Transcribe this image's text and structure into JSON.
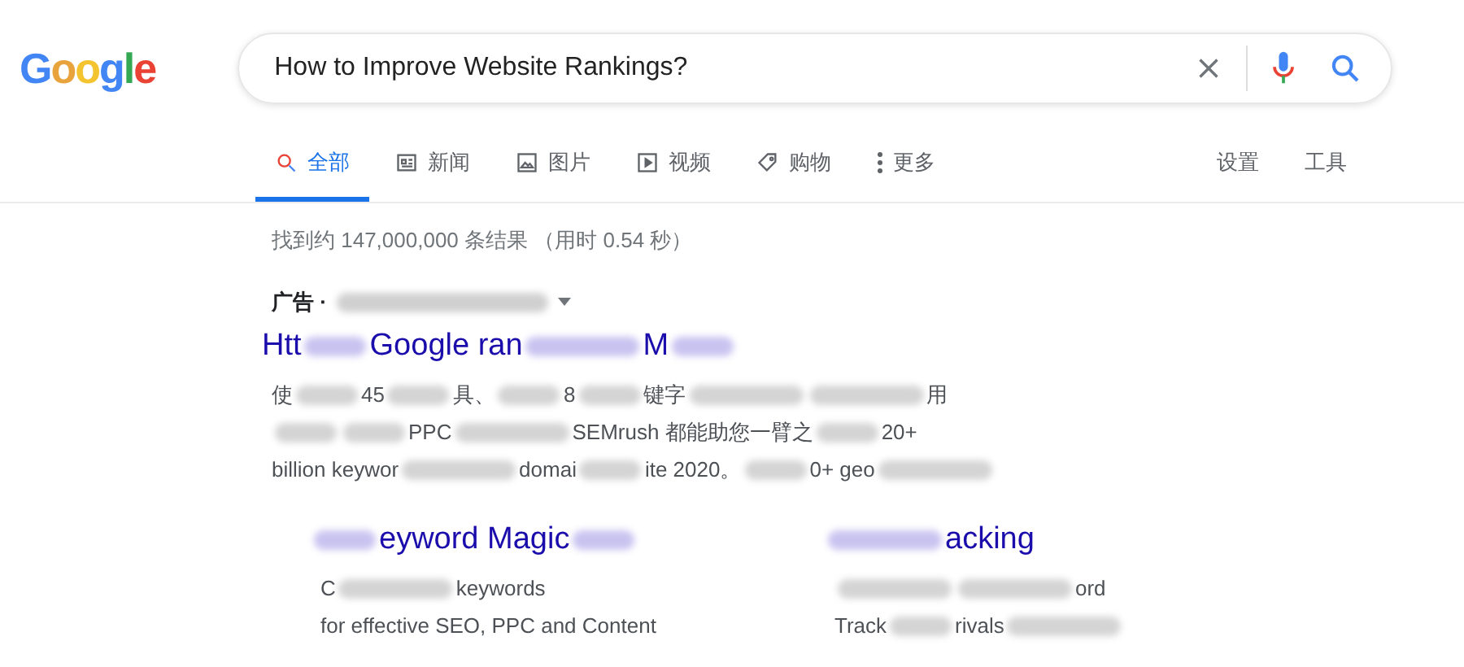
{
  "logo": {
    "letters": [
      "G",
      "o",
      "o",
      "g",
      "l",
      "e"
    ]
  },
  "search": {
    "value": "How to Improve Website Rankings?"
  },
  "tabs": [
    {
      "label": "全部",
      "kind": "search",
      "selected": true
    },
    {
      "label": "新闻",
      "kind": "news",
      "selected": false
    },
    {
      "label": "图片",
      "kind": "image",
      "selected": false
    },
    {
      "label": "视频",
      "kind": "video",
      "selected": false
    },
    {
      "label": "购物",
      "kind": "shopping",
      "selected": false
    },
    {
      "label": "更多",
      "kind": "more",
      "selected": false
    }
  ],
  "tools": [
    "设置",
    "工具"
  ],
  "result_stats": "找到约 147,000,000 条结果 （用时 0.54 秒）",
  "ad": {
    "label": "广告 ·",
    "title": [
      {
        "kind": "text",
        "text": "Htt"
      },
      {
        "kind": "blur"
      },
      {
        "kind": "text",
        "text": "Google ran"
      },
      {
        "kind": "blur_long"
      },
      {
        "kind": "text",
        "text": "M"
      },
      {
        "kind": "blur"
      }
    ],
    "description": [
      [
        {
          "kind": "text",
          "text": "使"
        },
        {
          "kind": "blur"
        },
        {
          "kind": "text",
          "text": "45"
        },
        {
          "kind": "blur"
        },
        {
          "kind": "text",
          "text": "具、"
        },
        {
          "kind": "blur"
        },
        {
          "kind": "text",
          "text": "8"
        },
        {
          "kind": "blur"
        },
        {
          "kind": "text",
          "text": "键字"
        },
        {
          "kind": "blur_long"
        },
        {
          "kind": "blur_long"
        },
        {
          "kind": "text",
          "text": "用"
        }
      ],
      [
        {
          "kind": "blur"
        },
        {
          "kind": "blur"
        },
        {
          "kind": "text",
          "text": "PPC"
        },
        {
          "kind": "blur_long"
        },
        {
          "kind": "text",
          "text": "SEMrush 都能助您一臂之"
        },
        {
          "kind": "blur"
        },
        {
          "kind": "text",
          "text": "20+"
        }
      ],
      [
        {
          "kind": "text",
          "text": "billion keywor"
        },
        {
          "kind": "blur_long"
        },
        {
          "kind": "text",
          "text": "domai"
        },
        {
          "kind": "blur"
        },
        {
          "kind": "text",
          "text": "ite 2020。"
        },
        {
          "kind": "blur"
        },
        {
          "kind": "text",
          "text": "0+ geo"
        },
        {
          "kind": "blur_long"
        }
      ]
    ],
    "sitelinks": [
      {
        "title": [
          {
            "kind": "blur"
          },
          {
            "kind": "text",
            "text": "eyword Magic"
          },
          {
            "kind": "blur"
          }
        ],
        "lines": [
          [
            {
              "kind": "text",
              "text": "C"
            },
            {
              "kind": "blur_long"
            },
            {
              "kind": "text",
              "text": "keywords"
            }
          ],
          [
            {
              "kind": "text",
              "text": "for effective SEO, PPC and Content"
            }
          ]
        ]
      },
      {
        "title": [
          {
            "kind": "blur_long"
          },
          {
            "kind": "text",
            "text": "acking"
          }
        ],
        "lines": [
          [
            {
              "kind": "blur_long"
            },
            {
              "kind": "blur_long"
            },
            {
              "kind": "text",
              "text": "ord"
            }
          ],
          [
            {
              "kind": "text",
              "text": "Track"
            },
            {
              "kind": "blur"
            },
            {
              "kind": "text",
              "text": "rivals"
            },
            {
              "kind": "blur_long"
            }
          ]
        ]
      }
    ]
  }
}
